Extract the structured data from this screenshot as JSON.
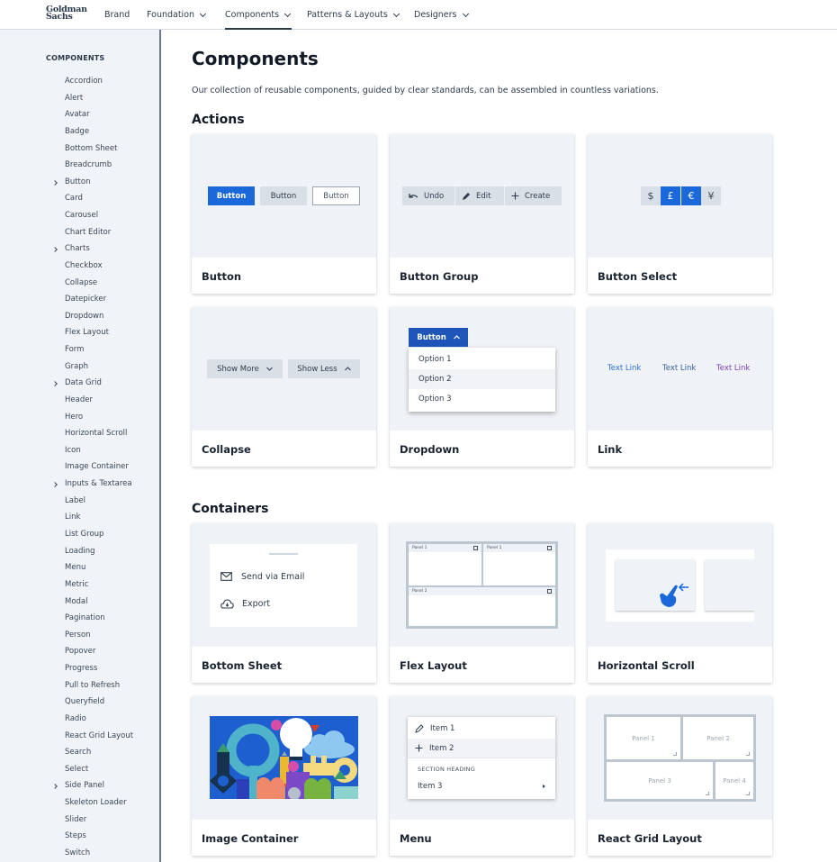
{
  "header": {
    "logo_line1": "Goldman",
    "logo_line2": "Sachs",
    "nav": [
      {
        "label": "Brand",
        "has_menu": false
      },
      {
        "label": "Foundation",
        "has_menu": true
      },
      {
        "label": "Components",
        "has_menu": true,
        "active": true
      },
      {
        "label": "Patterns & Layouts",
        "has_menu": true
      },
      {
        "label": "Designers",
        "has_menu": true
      }
    ]
  },
  "sidebar": {
    "title": "COMPONENTS",
    "items": [
      {
        "label": "Accordion"
      },
      {
        "label": "Alert"
      },
      {
        "label": "Avatar"
      },
      {
        "label": "Badge"
      },
      {
        "label": "Bottom Sheet"
      },
      {
        "label": "Breadcrumb"
      },
      {
        "label": "Button",
        "expandable": true
      },
      {
        "label": "Card"
      },
      {
        "label": "Carousel"
      },
      {
        "label": "Chart Editor"
      },
      {
        "label": "Charts",
        "expandable": true
      },
      {
        "label": "Checkbox"
      },
      {
        "label": "Collapse"
      },
      {
        "label": "Datepicker"
      },
      {
        "label": "Dropdown"
      },
      {
        "label": "Flex Layout"
      },
      {
        "label": "Form"
      },
      {
        "label": "Graph"
      },
      {
        "label": "Data Grid",
        "expandable": true
      },
      {
        "label": "Header"
      },
      {
        "label": "Hero"
      },
      {
        "label": "Horizontal Scroll"
      },
      {
        "label": "Icon"
      },
      {
        "label": "Image Container"
      },
      {
        "label": "Inputs & Textarea",
        "expandable": true
      },
      {
        "label": "Label"
      },
      {
        "label": "Link"
      },
      {
        "label": "List Group"
      },
      {
        "label": "Loading"
      },
      {
        "label": "Menu"
      },
      {
        "label": "Metric"
      },
      {
        "label": "Modal"
      },
      {
        "label": "Pagination"
      },
      {
        "label": "Person"
      },
      {
        "label": "Popover"
      },
      {
        "label": "Progress"
      },
      {
        "label": "Pull to Refresh"
      },
      {
        "label": "Queryfield"
      },
      {
        "label": "Radio"
      },
      {
        "label": "React Grid Layout"
      },
      {
        "label": "Search"
      },
      {
        "label": "Select"
      },
      {
        "label": "Side Panel",
        "expandable": true
      },
      {
        "label": "Skeleton Loader"
      },
      {
        "label": "Slider"
      },
      {
        "label": "Steps"
      },
      {
        "label": "Switch"
      }
    ]
  },
  "main": {
    "title": "Components",
    "description": "Our collection of reusable components, guided by clear standards, can be assembled in countless variations.",
    "sections": [
      {
        "title": "Actions",
        "cards": [
          {
            "label": "Button",
            "preview": {
              "buttons": [
                "Button",
                "Button",
                "Button"
              ]
            }
          },
          {
            "label": "Button Group",
            "preview": {
              "buttons": [
                {
                  "icon": "undo-icon",
                  "label": "Undo"
                },
                {
                  "icon": "pencil-icon",
                  "label": "Edit"
                },
                {
                  "icon": "plus-icon",
                  "label": "Create"
                }
              ]
            }
          },
          {
            "label": "Button Select",
            "preview": {
              "options": [
                {
                  "symbol": "$",
                  "selected": false
                },
                {
                  "symbol": "£",
                  "selected": true
                },
                {
                  "symbol": "€",
                  "selected": true
                },
                {
                  "symbol": "¥",
                  "selected": false
                }
              ]
            }
          },
          {
            "label": "Collapse",
            "preview": {
              "buttons": [
                "Show More",
                "Show Less"
              ]
            }
          },
          {
            "label": "Dropdown",
            "preview": {
              "button": "Button",
              "options": [
                "Option 1",
                "Option 2",
                "Option 3"
              ],
              "hovered": "Option 2"
            }
          },
          {
            "label": "Link",
            "preview": {
              "links": [
                "Text Link",
                "Text Link",
                "Text Link"
              ],
              "colors": [
                "#2e6fd8",
                "#3a5d9a",
                "#7a3fb0"
              ]
            }
          }
        ]
      },
      {
        "title": "Containers",
        "cards": [
          {
            "label": "Bottom Sheet",
            "preview": {
              "items": [
                {
                  "icon": "envelope-icon",
                  "label": "Send via Email"
                },
                {
                  "icon": "cloud-download-icon",
                  "label": "Export"
                }
              ]
            }
          },
          {
            "label": "Flex Layout",
            "preview": {
              "panels": [
                "Panel 1",
                "Panel 1",
                "Panel 2"
              ]
            }
          },
          {
            "label": "Horizontal Scroll",
            "preview": {}
          },
          {
            "label": "Image Container",
            "preview": {}
          },
          {
            "label": "Menu",
            "preview": {
              "items": [
                {
                  "icon": "pencil-icon",
                  "label": "Item 1"
                },
                {
                  "icon": "plus-icon",
                  "label": "Item 2"
                }
              ],
              "section_heading": "SECTION HEADING",
              "submenu_item": "Item 3"
            }
          },
          {
            "label": "React Grid Layout",
            "preview": {
              "panels": [
                "Panel 1",
                "Panel 2",
                "Panel 3",
                "Panel 4"
              ]
            }
          }
        ]
      }
    ]
  },
  "colors": {
    "primary": "#1a68d9",
    "sidebar_bg": "#f0f3f7",
    "card_preview_bg": "#eff2f6"
  }
}
